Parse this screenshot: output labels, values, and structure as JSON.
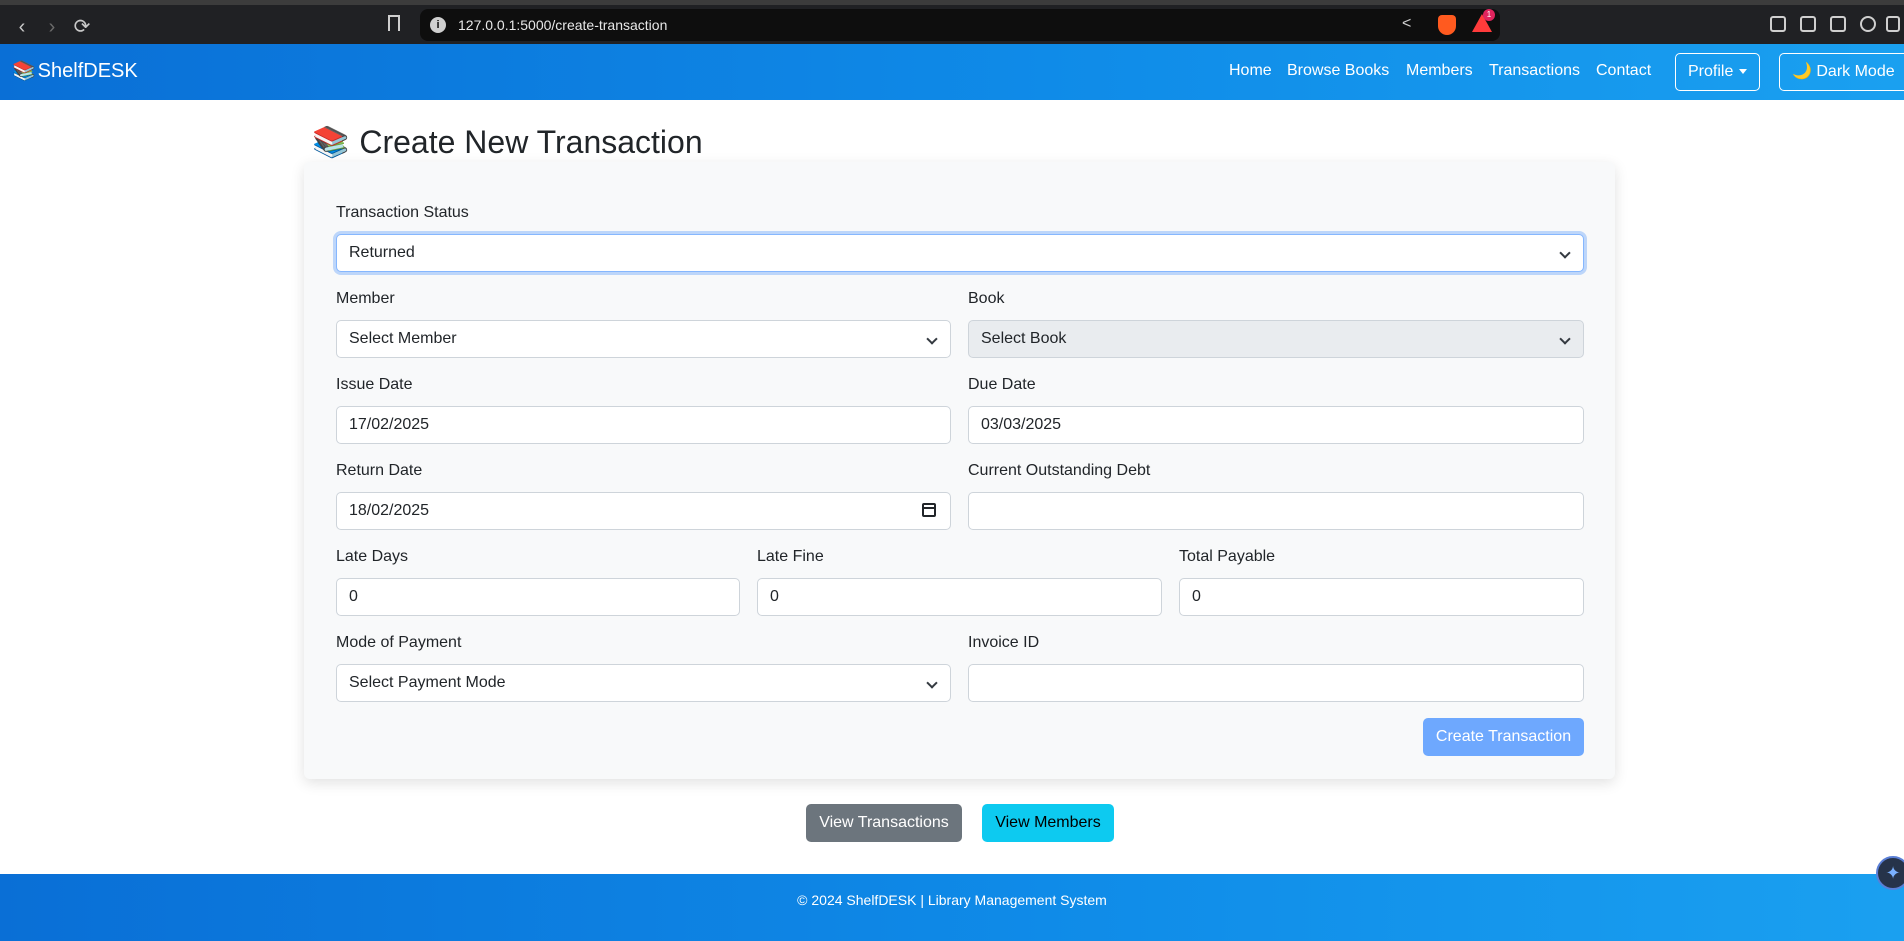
{
  "browser": {
    "url": "127.0.0.1:5000/create-transaction",
    "back_icon": "‹",
    "forward_icon": "›",
    "reload_icon": "⟳",
    "rewards_badge": "1"
  },
  "navbar": {
    "brand": "ShelfDESK",
    "brand_icon": "📚",
    "links": {
      "home": "Home",
      "browse_books": "Browse Books",
      "members": "Members",
      "transactions": "Transactions",
      "contact": "Contact"
    },
    "profile_label": "Profile",
    "dark_mode_label": "🌙 Dark Mode",
    "colors": {
      "gradient_start": "#0a6fd6",
      "gradient_end": "#1aa0f0"
    }
  },
  "page": {
    "title": "Create New Transaction",
    "title_icon": "📚"
  },
  "form": {
    "transaction_status": {
      "label": "Transaction Status",
      "value": "Returned"
    },
    "member": {
      "label": "Member",
      "value": "Select Member"
    },
    "book": {
      "label": "Book",
      "value": "Select Book"
    },
    "issue_date": {
      "label": "Issue Date",
      "value": "17/02/2025"
    },
    "due_date": {
      "label": "Due Date",
      "value": "03/03/2025"
    },
    "return_date": {
      "label": "Return Date",
      "value": "18/02/2025"
    },
    "outstanding_debt": {
      "label": "Current Outstanding Debt",
      "value": ""
    },
    "late_days": {
      "label": "Late Days",
      "value": "0"
    },
    "late_fine": {
      "label": "Late Fine",
      "value": "0"
    },
    "total_payable": {
      "label": "Total Payable",
      "value": "0"
    },
    "payment_mode": {
      "label": "Mode of Payment",
      "value": "Select Payment Mode"
    },
    "invoice_id": {
      "label": "Invoice ID",
      "value": ""
    },
    "submit_label": "Create Transaction"
  },
  "actions": {
    "view_transactions": "View Transactions",
    "view_members": "View Members"
  },
  "footer": {
    "text": "© 2024 ShelfDESK | Library Management System"
  }
}
